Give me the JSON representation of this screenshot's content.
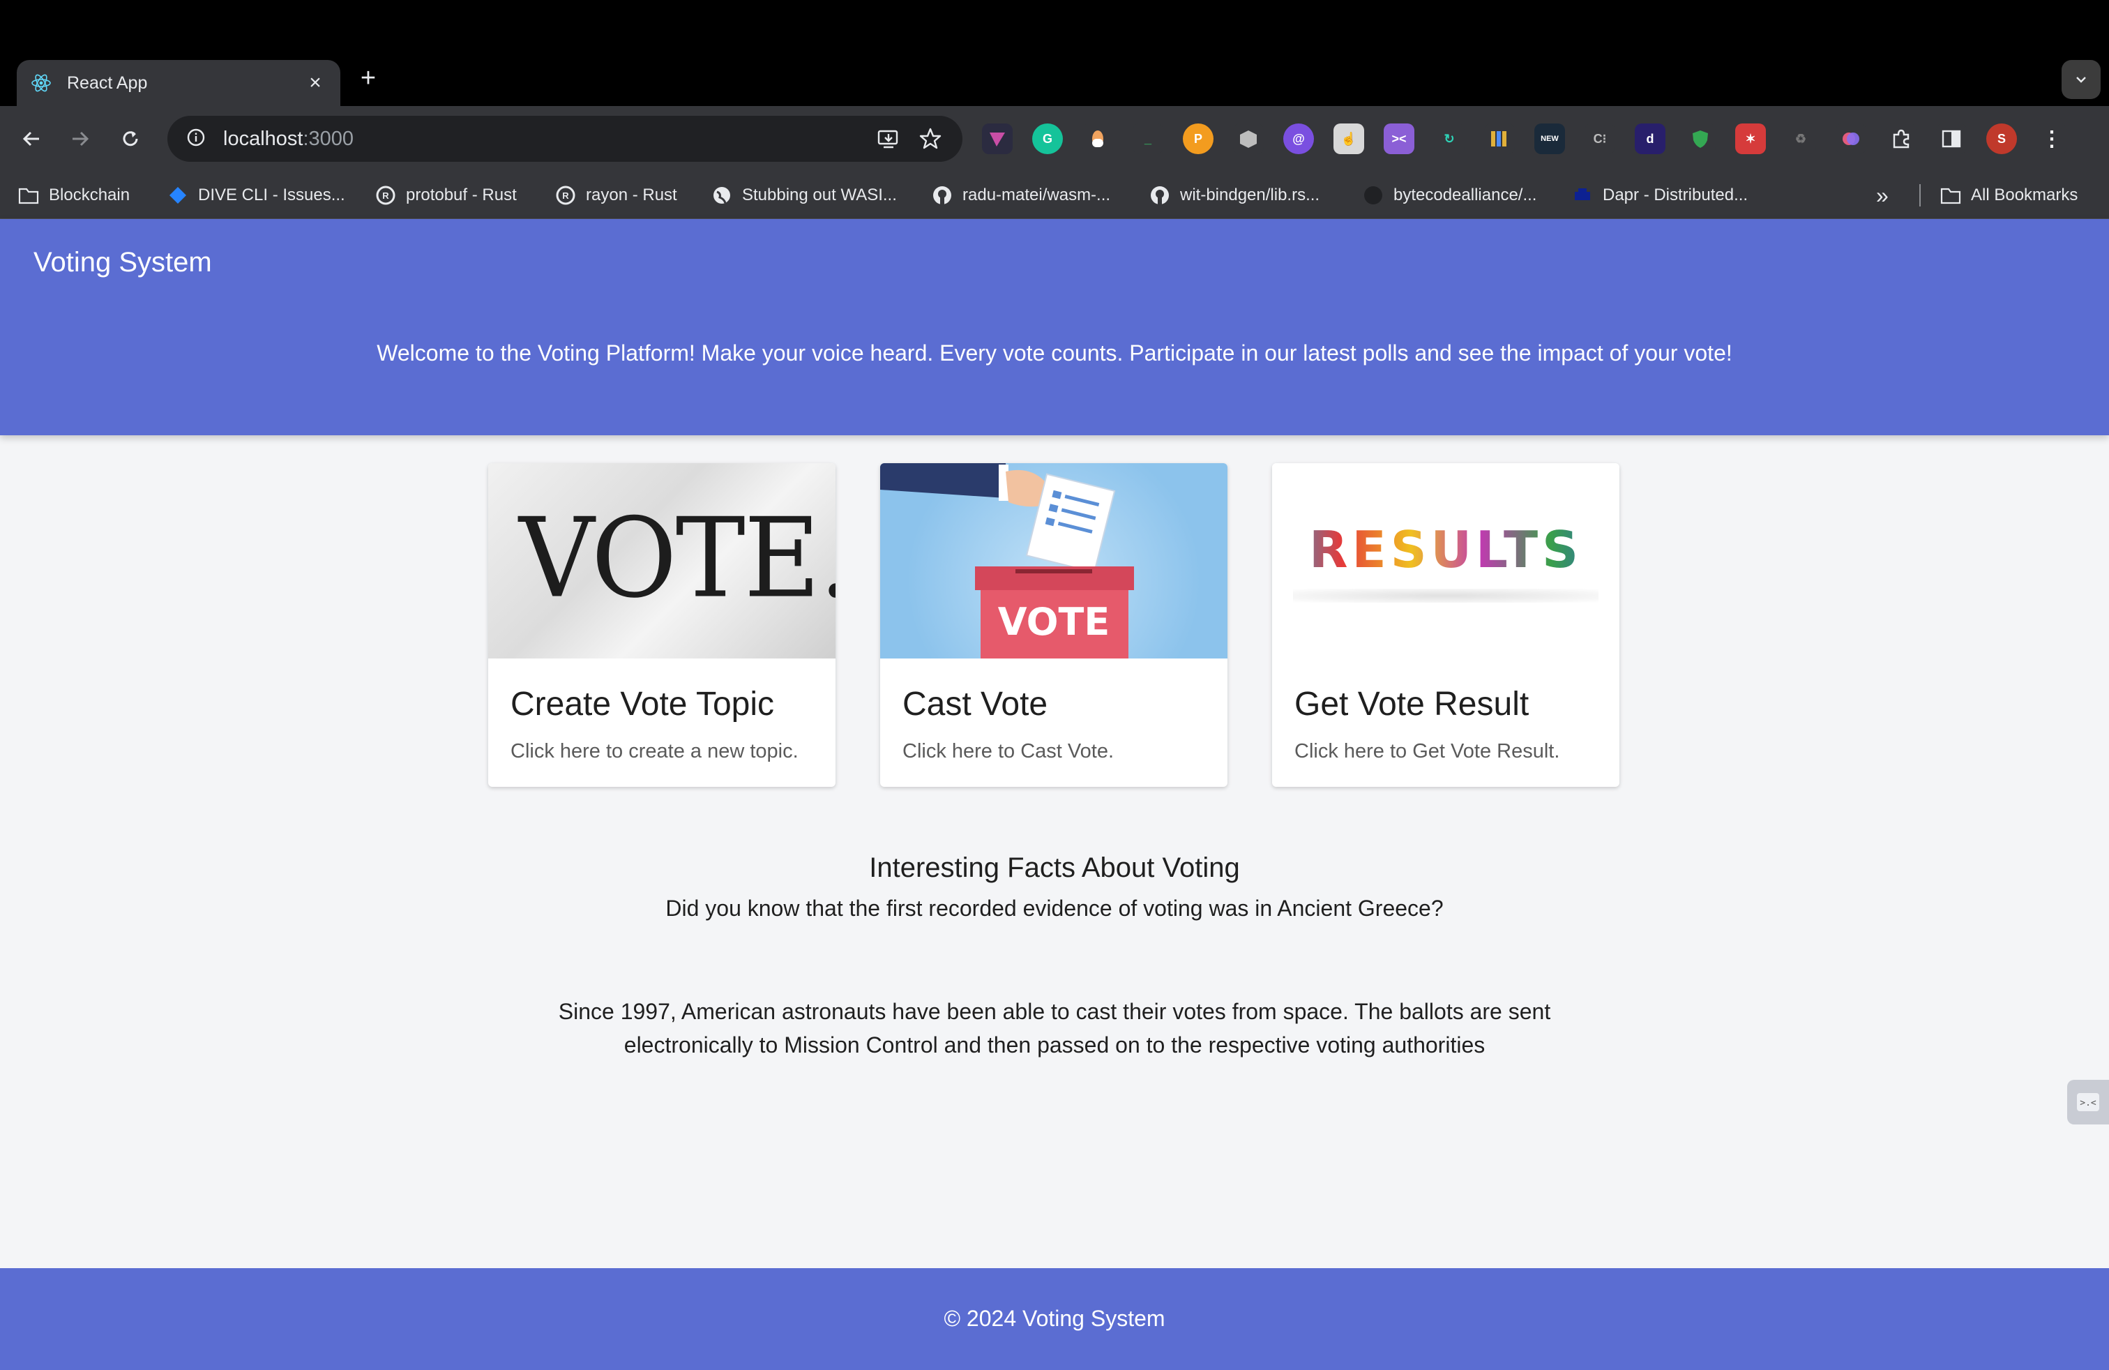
{
  "browser": {
    "tab_title": "React App",
    "url_host": "localhost",
    "url_port": ":3000",
    "profile_initial": "S",
    "extensions": [
      "grammarly",
      "dapp-extension",
      "wasm-extension",
      "bookmark-extension"
    ],
    "bookmarks": [
      {
        "label": "Blockchain",
        "icon": "folder-icon"
      },
      {
        "label": "DIVE CLI - Issues...",
        "icon": "jira-icon"
      },
      {
        "label": "protobuf - Rust",
        "icon": "rust-icon"
      },
      {
        "label": "rayon - Rust",
        "icon": "rust-icon"
      },
      {
        "label": "Stubbing out WASI...",
        "icon": "globe-icon"
      },
      {
        "label": "radu-matei/wasm-...",
        "icon": "github-icon"
      },
      {
        "label": "wit-bindgen/lib.rs...",
        "icon": "github-icon"
      },
      {
        "label": "bytecodealliance/...",
        "icon": "github-icon"
      },
      {
        "label": "Dapr - Distributed...",
        "icon": "dapr-icon"
      }
    ],
    "all_bookmarks": "All Bookmarks"
  },
  "header": {
    "title": "Voting System",
    "welcome": "Welcome to the Voting Platform! Make your voice heard. Every vote counts. Participate in our latest polls and see the impact of your vote!"
  },
  "cards": [
    {
      "title": "Create Vote Topic",
      "desc": "Click here to create a new topic.",
      "image_text": "VOTE."
    },
    {
      "title": "Cast Vote",
      "desc": "Click here to Cast Vote.",
      "image_text": "VOTE"
    },
    {
      "title": "Get Vote Result",
      "desc": "Click here to Get Vote Result.",
      "image_text": "RESULTS"
    }
  ],
  "facts": {
    "title": "Interesting Facts About Voting",
    "line1": "Did you know that the first recorded evidence of voting was in Ancient Greece?",
    "line2": "Since 1997, American astronauts have been able to cast their votes from space. The ballots are sent electronically to Mission Control and then passed on to the respective voting authorities"
  },
  "footer": {
    "text": "© 2024 Voting System"
  }
}
